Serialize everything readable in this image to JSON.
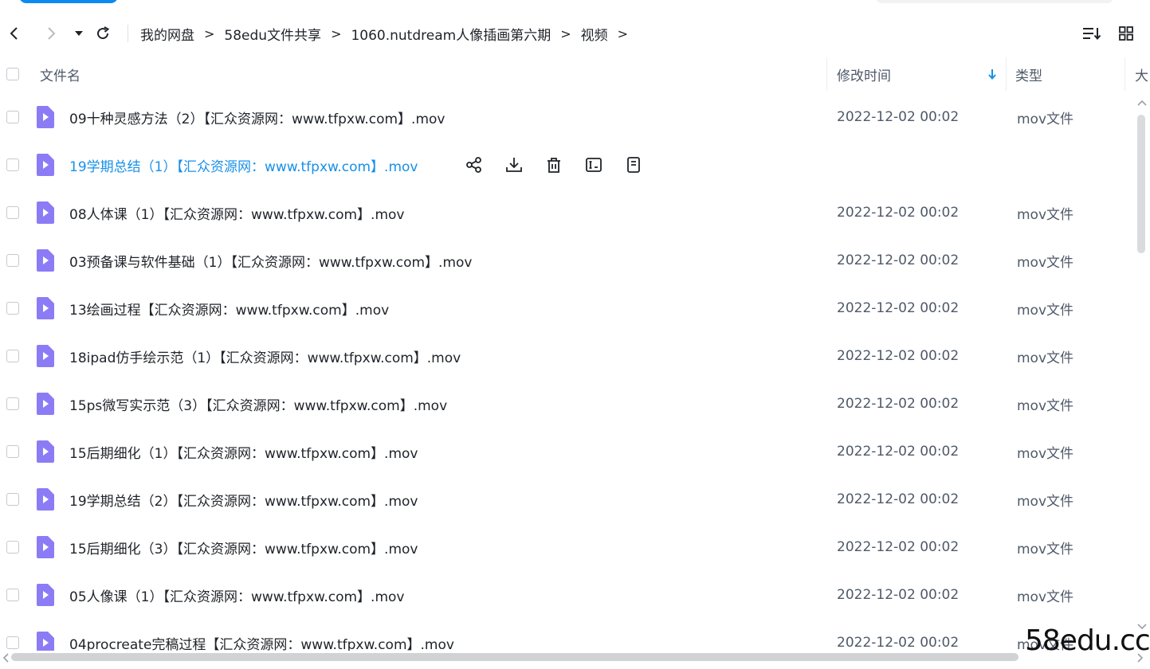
{
  "toolbar": {
    "back_icon": "chevron-left-icon",
    "forward_icon": "chevron-right-icon",
    "history_icon": "caret-down-icon",
    "refresh_icon": "refresh-icon",
    "sort_icon": "sort-list-icon",
    "grid_icon": "grid-view-icon"
  },
  "breadcrumb": {
    "items": [
      "我的网盘",
      "58edu文件共享",
      "1060.nutdream人像插画第六期",
      "视频"
    ],
    "separator": ">"
  },
  "columns": {
    "name": "文件名",
    "modified": "修改时间",
    "type": "类型",
    "size": "大"
  },
  "files": [
    {
      "name": "09十种灵感方法（2）【汇众资源网：www.tfpxw.com】.mov",
      "modified": "2022-12-02 00:02",
      "type": "mov文件"
    },
    {
      "name": "19学期总结（1）【汇众资源网：www.tfpxw.com】.mov",
      "modified": "",
      "type": ""
    },
    {
      "name": "08人体课（1）【汇众资源网：www.tfpxw.com】.mov",
      "modified": "2022-12-02 00:02",
      "type": "mov文件"
    },
    {
      "name": "03预备课与软件基础（1）【汇众资源网：www.tfpxw.com】.mov",
      "modified": "2022-12-02 00:02",
      "type": "mov文件"
    },
    {
      "name": "13绘画过程【汇众资源网：www.tfpxw.com】.mov",
      "modified": "2022-12-02 00:02",
      "type": "mov文件"
    },
    {
      "name": "18ipad仿手绘示范（1）【汇众资源网：www.tfpxw.com】.mov",
      "modified": "2022-12-02 00:02",
      "type": "mov文件"
    },
    {
      "name": "15ps微写实示范（3）【汇众资源网：www.tfpxw.com】.mov",
      "modified": "2022-12-02 00:02",
      "type": "mov文件"
    },
    {
      "name": "15后期细化（1）【汇众资源网：www.tfpxw.com】.mov",
      "modified": "2022-12-02 00:02",
      "type": "mov文件"
    },
    {
      "name": "19学期总结（2）【汇众资源网：www.tfpxw.com】.mov",
      "modified": "2022-12-02 00:02",
      "type": "mov文件"
    },
    {
      "name": "15后期细化（3）【汇众资源网：www.tfpxw.com】.mov",
      "modified": "2022-12-02 00:02",
      "type": "mov文件"
    },
    {
      "name": "05人像课（1）【汇众资源网：www.tfpxw.com】.mov",
      "modified": "2022-12-02 00:02",
      "type": "mov文件"
    },
    {
      "name": "04procreate完稿过程【汇众资源网：www.tfpxw.com】.mov",
      "modified": "2022-12-02 00:02",
      "type": "mov文件"
    }
  ],
  "hover_actions": [
    "share-icon",
    "download-icon",
    "delete-icon",
    "rename-icon",
    "more-info-icon"
  ],
  "watermark": "58edu.cc",
  "colors": {
    "accent": "#1890e8",
    "video_icon": "#8b7cf6",
    "text": "#1f2329",
    "muted": "#4e5969"
  }
}
